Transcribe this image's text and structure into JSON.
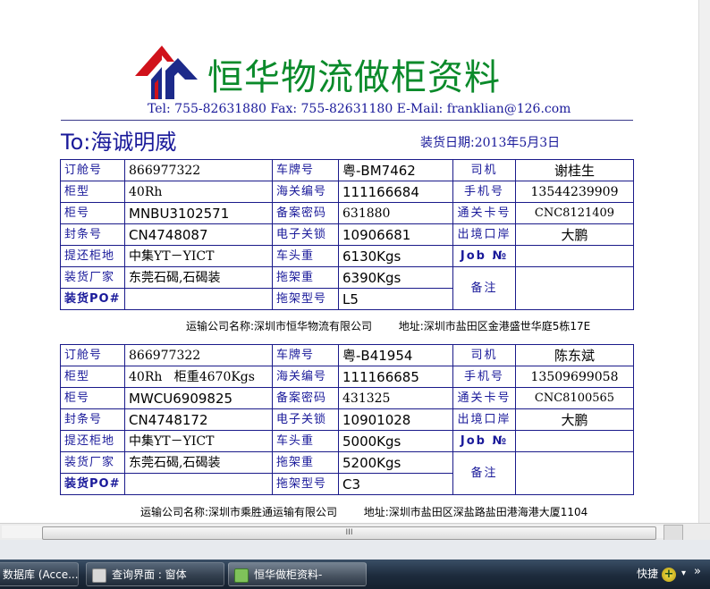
{
  "document": {
    "company_title": "恒华物流做柜资料",
    "contact_line": "Tel: 755-82631880  Fax: 755-82631180  E-Mail: franklian@126.com",
    "to_line": "To:海诚明威",
    "ship_date_label": "装货日期:",
    "ship_date_value": "2013年5月3日"
  },
  "labels": {
    "order_no": "订舱号",
    "container_type": "柜型",
    "container_no": "柜号",
    "seal_no": "封条号",
    "pickup_place": "提还柜地",
    "loading_factory": "装货厂家",
    "loading_po": "装货PO#",
    "plate_no": "车牌号",
    "customs_no": "海关编号",
    "record_password": "备案密码",
    "e_lock": "电子关锁",
    "truck_weight": "车头重",
    "trailer_weight": "拖架重",
    "trailer_model": "拖架型号",
    "driver": "司机",
    "mobile": "手机号",
    "pass_card": "通关卡号",
    "exit_port": "出境口岸",
    "job_no": "Job №",
    "remarks": "备注",
    "transport_company": "运输公司名称:",
    "address": "地址:"
  },
  "records": [
    {
      "order_no": "866977322",
      "container_type": "40Rh",
      "container_no": "MNBU3102571",
      "seal_no": "CN4748087",
      "pickup_place": "中集YT－YICT",
      "loading_factory": "东莞石碣,石碣装",
      "loading_po": "",
      "plate_no": "粤-BM7462",
      "customs_no": "111166684",
      "record_password": "631880",
      "e_lock": "10906681",
      "truck_weight": "6130Kgs",
      "trailer_weight": "6390Kgs",
      "trailer_model": "L5",
      "driver": "谢桂生",
      "mobile": "13544239909",
      "pass_card": "CNC8121409",
      "exit_port": "大鹏",
      "job_no": "",
      "remarks": "",
      "transport_company": "深圳市恒华物流有限公司",
      "address": "深圳市盐田区金港盛世华庭5栋17E"
    },
    {
      "order_no": "866977322",
      "container_type": "40Rh   柜重4670Kgs",
      "container_no": "MWCU6909825",
      "seal_no": "CN4748172",
      "pickup_place": "中集YT－YICT",
      "loading_factory": "东莞石碣,石碣装",
      "loading_po": "",
      "plate_no": "粤-B41954",
      "customs_no": "111166685",
      "record_password": "431325",
      "e_lock": "10901028",
      "truck_weight": "5000Kgs",
      "trailer_weight": "5200Kgs",
      "trailer_model": "C3",
      "driver": "陈东斌",
      "mobile": "13509699058",
      "pass_card": "CNC8100565",
      "exit_port": "大鹏",
      "job_no": "",
      "remarks": "",
      "transport_company": "深圳市乘胜通运输有限公司",
      "address": "深圳市盐田区深盐路盐田港海港大厦1104"
    }
  ],
  "taskbar": {
    "items": [
      {
        "label": "数据库 (Acce..."
      },
      {
        "label": "查询界面 : 窗体"
      },
      {
        "label": "恒华做柜资料-"
      }
    ],
    "quick_label": "快捷"
  },
  "scrollbar": {
    "thumb_grip": "III"
  },
  "colors": {
    "title_green": "#0a8a2a",
    "label_blue": "#1a1a9a",
    "logo_red": "#d0121b",
    "logo_blue": "#1c2a8a"
  }
}
